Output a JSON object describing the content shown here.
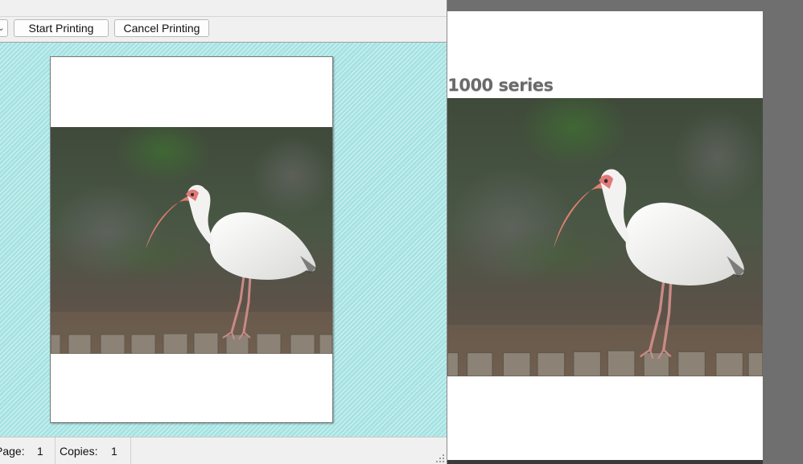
{
  "toolbar": {
    "start_label": "Start Printing",
    "cancel_label": "Cancel Printing",
    "partial_dropdown_glyph": "⌄"
  },
  "status": {
    "page_label": "Page:",
    "page_value": "1",
    "copies_label": "Copies:",
    "copies_value": "1"
  },
  "document": {
    "heading": "-1000 series"
  },
  "colors": {
    "preview_bg": "#a6e3e3",
    "window_bg": "#f0f0f0"
  },
  "icons": {
    "photo": "white-ibis-on-fence",
    "grip": "resize-grip-icon"
  }
}
